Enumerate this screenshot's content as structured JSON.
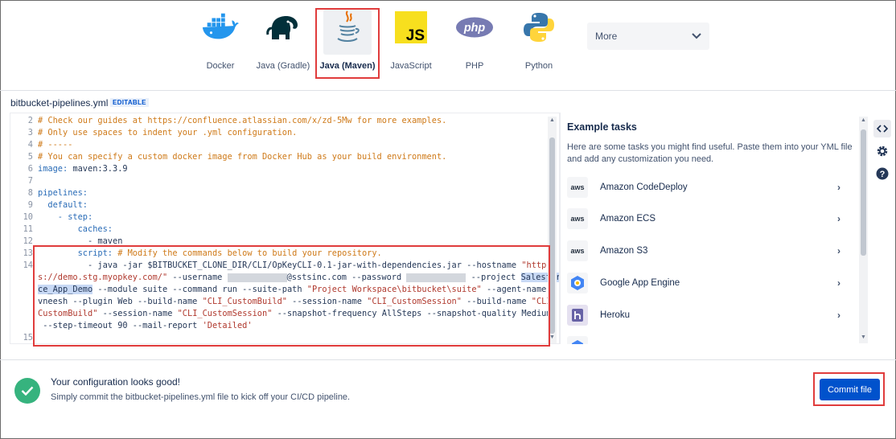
{
  "languages": [
    {
      "name": "Docker",
      "icon": "docker-whale-icon"
    },
    {
      "name": "Java (Gradle)",
      "icon": "gradle-elephant-icon"
    },
    {
      "name": "Java (Maven)",
      "icon": "java-cup-icon",
      "selected": true
    },
    {
      "name": "JavaScript",
      "icon": "javascript-icon"
    },
    {
      "name": "PHP",
      "icon": "php-icon"
    },
    {
      "name": "Python",
      "icon": "python-icon"
    }
  ],
  "more_select": {
    "value": "More"
  },
  "editor": {
    "file_name": "bitbucket-pipelines.yml",
    "badge": "EDITABLE",
    "lines": {
      "l2": "# Check our guides at https://confluence.atlassian.com/x/zd-5Mw for more examples.",
      "l3": "# Only use spaces to indent your .yml configuration.",
      "l4": "# -----",
      "l5": "# You can specify a custom docker image from Docker Hub as your build environment.",
      "l6a": "image:",
      "l6b": " maven:3.3.9",
      "l8": "pipelines:",
      "l9": "  default:",
      "l10": "    - step:",
      "l11": "        caches:",
      "l12": "          - maven",
      "l13a": "        script:",
      "l13b": " # Modify the commands below to build your repository.",
      "l14a": "          - java -jar $BITBUCKET_CLONE_DIR/CLI/OpKeyCLI-0.1-jar-with-dependencies.jar --hostname ",
      "l14b": "\"http",
      "w1a": "s://demo.stg.myopkey.com/\"",
      "w1b": " --username ",
      "w1c": "@sstsinc.com --password ",
      "w1d": " --project ",
      "w1e": "Salesfor",
      "w2a": "ce_App_Demo",
      "w2b": " --module suite --command run --suite-path ",
      "w2c": "\"Project Workspace\\bitbucket\\suite\"",
      "w2d": " --agent-name a",
      "w3a": "vneesh --plugin Web --build-name ",
      "w3b": "\"CLI_CustomBuild\"",
      "w3c": " --session-name ",
      "w3d": "\"CLI_CustomSession\"",
      "w3e": " --build-name ",
      "w3f": "\"CLI_",
      "w4a": "CustomBuild\"",
      "w4b": " --session-name ",
      "w4c": "\"CLI_CustomSession\"",
      "w4d": " --snapshot-frequency AllSteps --snapshot-quality Medium",
      "w5a": " --step-timeout 90 --mail-report ",
      "w5b": "'Detailed'"
    },
    "line_numbers": [
      "2",
      "3",
      "4",
      "5",
      "6",
      "7",
      "8",
      "9",
      "10",
      "11",
      "12",
      "13",
      "14",
      "15"
    ]
  },
  "tasks_panel": {
    "title": "Example tasks",
    "description": "Here are some tasks you might find useful. Paste them into your YML file and add any customization you need.",
    "items": [
      {
        "label": "Amazon CodeDeploy",
        "icon": "aws-icon"
      },
      {
        "label": "Amazon ECS",
        "icon": "aws-icon"
      },
      {
        "label": "Amazon S3",
        "icon": "aws-icon"
      },
      {
        "label": "Google App Engine",
        "icon": "google-app-engine-icon"
      },
      {
        "label": "Heroku",
        "icon": "heroku-icon"
      }
    ],
    "aws_text": "aws"
  },
  "status": {
    "title": "Your configuration looks good!",
    "description": "Simply commit the bitbucket-pipelines.yml file to kick off your CI/CD pipeline."
  },
  "commit_button": "Commit file",
  "colors": {
    "primary": "#0052cc",
    "success": "#36b37e",
    "highlight_border": "#e03c3c"
  }
}
